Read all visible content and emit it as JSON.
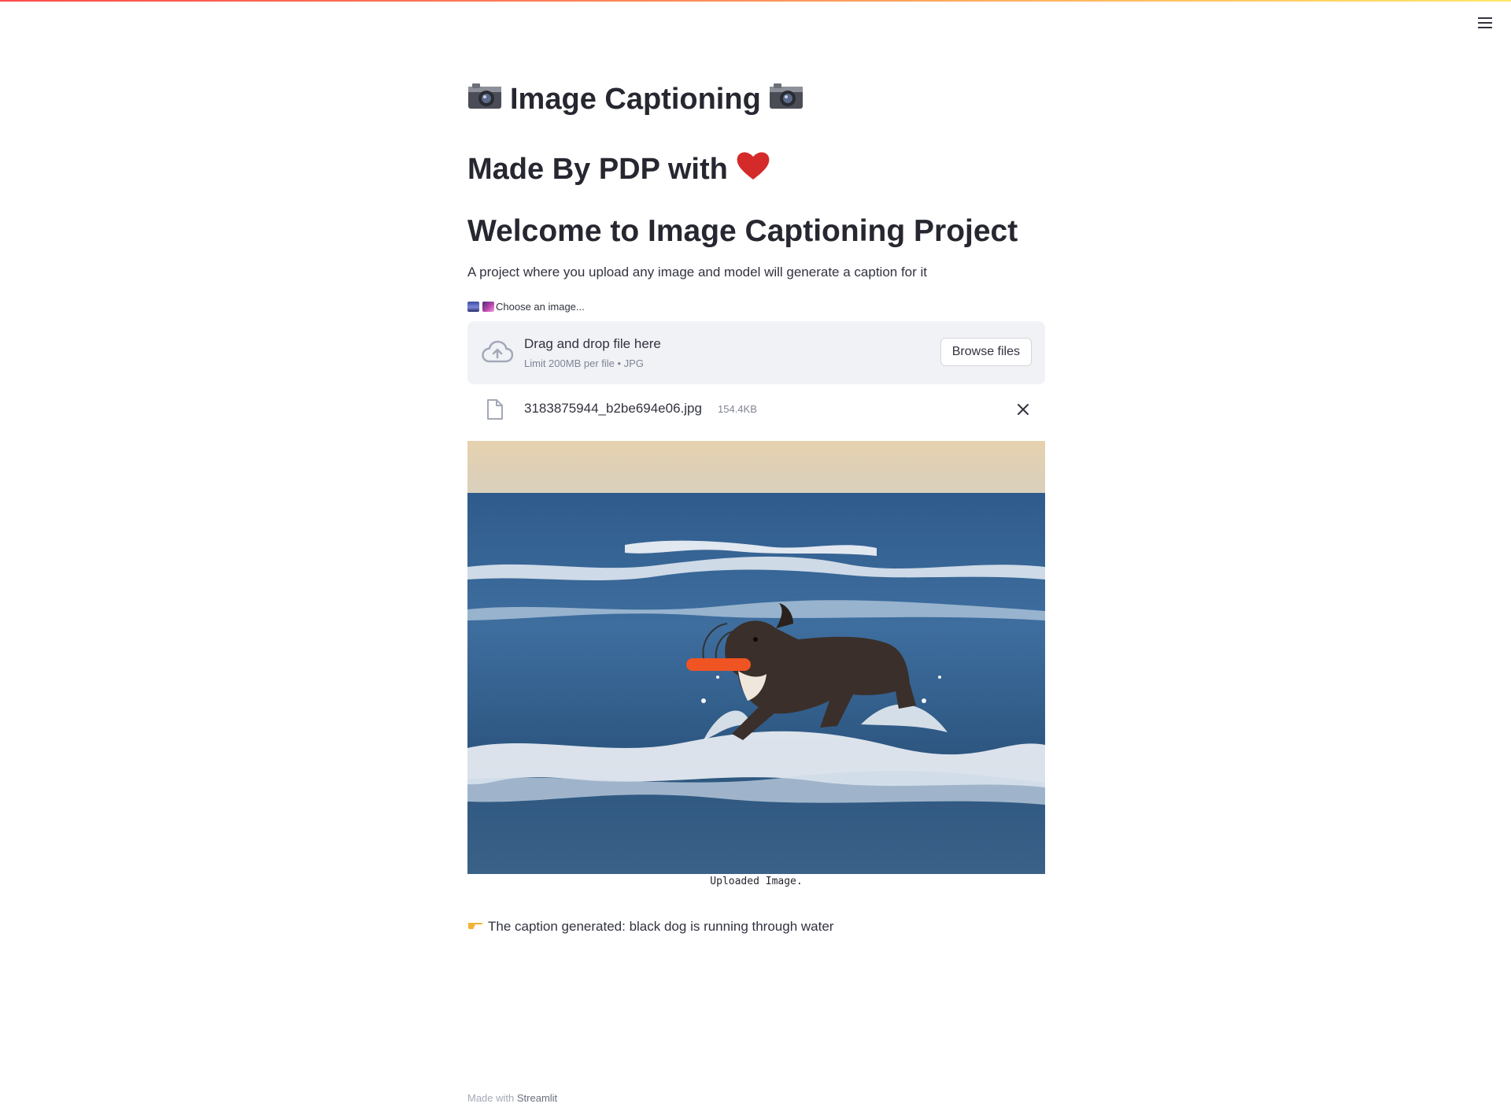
{
  "header": {
    "menu_icon": "hamburger-menu-icon"
  },
  "main": {
    "title": "Image Captioning",
    "title_icon": "camera-icon",
    "subtitle": "Made By PDP with",
    "subtitle_icon": "heart-icon",
    "heading": "Welcome to Image Captioning Project",
    "description": "A project where you upload any image and model will generate a caption for it",
    "uploader": {
      "label": "Choose an image...",
      "dropzone_text": "Drag and drop file here",
      "limit_text": "Limit 200MB per file • JPG",
      "browse_label": "Browse files",
      "file_name": "3183875944_b2be694e06.jpg",
      "file_size": "154.4KB"
    },
    "image_caption": "Uploaded Image.",
    "result_text": "The caption generated: black dog is running through water"
  },
  "footer": {
    "prefix": "Made with",
    "link": "Streamlit"
  },
  "colors": {
    "accent_gradient_start": "#ff4b4b",
    "accent_gradient_end": "#ffe86a",
    "dropzone_bg": "#f0f2f6",
    "text": "#262730"
  }
}
